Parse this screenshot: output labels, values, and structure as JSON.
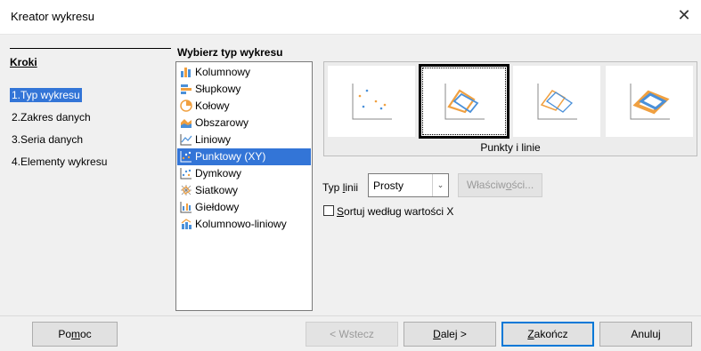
{
  "window": {
    "title": "Kreator wykresu",
    "close_glyph": "✕"
  },
  "steps": {
    "heading": "Kroki",
    "items": [
      {
        "label": "1.Typ wykresu",
        "active": true
      },
      {
        "label": "2.Zakres danych",
        "active": false
      },
      {
        "label": "3.Seria danych",
        "active": false
      },
      {
        "label": "4.Elementy wykresu",
        "active": false
      }
    ]
  },
  "chart_types": {
    "heading": "Wybierz typ wykresu",
    "items": [
      {
        "label": "Kolumnowy",
        "icon": "column-chart-icon"
      },
      {
        "label": "Słupkowy",
        "icon": "bar-chart-icon"
      },
      {
        "label": "Kołowy",
        "icon": "pie-chart-icon"
      },
      {
        "label": "Obszarowy",
        "icon": "area-chart-icon"
      },
      {
        "label": "Liniowy",
        "icon": "line-chart-icon"
      },
      {
        "label": "Punktowy (XY)",
        "icon": "scatter-chart-icon",
        "selected": true
      },
      {
        "label": "Dymkowy",
        "icon": "bubble-chart-icon"
      },
      {
        "label": "Siatkowy",
        "icon": "net-chart-icon"
      },
      {
        "label": "Giełdowy",
        "icon": "stock-chart-icon"
      },
      {
        "label": "Kolumnowo-liniowy",
        "icon": "column-line-chart-icon"
      }
    ]
  },
  "variants": {
    "selected_label": "Punkty i linie",
    "items": [
      {
        "name": "points-only"
      },
      {
        "name": "points-and-lines",
        "selected": true
      },
      {
        "name": "lines-only"
      },
      {
        "name": "3d-xy"
      }
    ]
  },
  "line_type": {
    "label_prefix": "Typ ",
    "label_accel": "l",
    "label_suffix": "inii",
    "value": "Prosty"
  },
  "properties_button": {
    "prefix": "Właściw",
    "accel": "o",
    "suffix": "ści..."
  },
  "sort_checkbox": {
    "accel": "S",
    "rest": "ortuj według wartości X",
    "checked": false
  },
  "footer": {
    "help": {
      "prefix": "Po",
      "accel": "m",
      "suffix": "oc"
    },
    "back": "< Wstecz",
    "next": {
      "accel": "D",
      "suffix": "alej >"
    },
    "finish": {
      "accel": "Z",
      "suffix": "akończ"
    },
    "cancel": "Anuluj"
  },
  "colors": {
    "accent": "#3375d7",
    "series_orange": "#f0a040",
    "series_blue": "#4a90d9"
  }
}
